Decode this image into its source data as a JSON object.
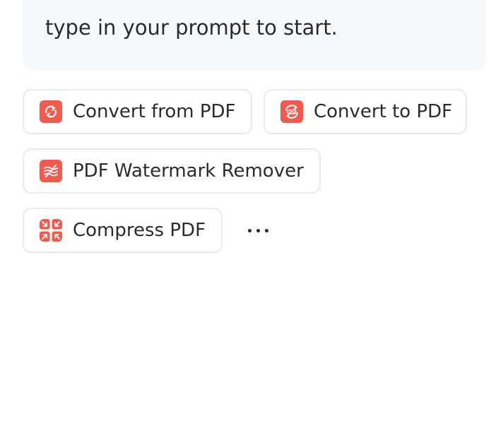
{
  "prompt": {
    "text": "type in your prompt to start."
  },
  "tools": [
    {
      "label": "Convert from PDF",
      "icon": "convert-from-pdf-icon"
    },
    {
      "label": "Convert to PDF",
      "icon": "convert-to-pdf-icon",
      "icon_text": "PDF"
    },
    {
      "label": "PDF Watermark Remover",
      "icon": "watermark-remover-icon"
    },
    {
      "label": "Compress PDF",
      "icon": "compress-icon"
    }
  ],
  "more": {
    "icon": "more-icon"
  },
  "colors": {
    "accent": "#f15b4f",
    "card_bg": "#f7f8fa",
    "chip_border": "#e9eaee",
    "text": "#2b2b2b"
  }
}
